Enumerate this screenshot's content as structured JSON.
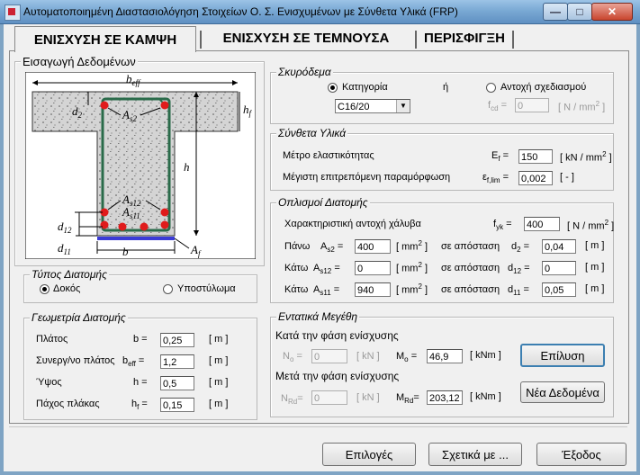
{
  "window": {
    "title": "Αυτοματοποιημένη Διαστασιολόγηση Στοιχείων Ο. Σ. Ενισχυμένων με Σύνθετα Υλικά  (FRP)",
    "min_glyph": "—",
    "max_glyph": "□",
    "close_glyph": "✕"
  },
  "tabs": [
    {
      "label": "ΕΝΙΣΧΥΣΗ ΣΕ ΚΑΜΨΗ",
      "active": true
    },
    {
      "label": "ΕΝΙΣΧΥΣΗ ΣΕ ΤΕΜΝΟΥΣΑ",
      "active": false
    },
    {
      "label": "ΠΕΡΙΣΦΙΓΞΗ",
      "active": false
    }
  ],
  "input_section": {
    "title": "Εισαγωγή Δεδομένων"
  },
  "diagram": {
    "labels": {
      "beff_b": "b",
      "beff_s": "eff",
      "d2_b": "d",
      "d2_s": "2",
      "as2_b": "A",
      "as2_s": "s2",
      "hf_b": "h",
      "hf_s": "f",
      "h": "h",
      "as12_b": "A",
      "as12_s": "s12",
      "as11_b": "A",
      "as11_s": "s11",
      "d12_b": "d",
      "d12_s": "12",
      "d11_b": "d",
      "d11_s": "11",
      "b": "b",
      "af_b": "A",
      "af_s": "f"
    }
  },
  "section_type": {
    "title": "Τύπος Διατομής",
    "options": [
      {
        "label": "Δοκός",
        "selected": true
      },
      {
        "label": "Υποστύλωμα",
        "selected": false
      }
    ]
  },
  "geometry": {
    "title": "Γεωμετρία Διατομής",
    "rows": [
      {
        "label": "Πλάτος",
        "sym": "b",
        "sub": "",
        "value": "0,25",
        "unit": "[ m ]"
      },
      {
        "label": "Συνεργ/νο πλάτος",
        "sym": "b",
        "sub": "eff",
        "value": "1,2",
        "unit": "[ m ]"
      },
      {
        "label": "Ύψος",
        "sym": "h",
        "sub": "",
        "value": "0,5",
        "unit": "[ m ]"
      },
      {
        "label": "Πάχος πλάκας",
        "sym": "h",
        "sub": "f",
        "value": "0,15",
        "unit": "[ m ]"
      }
    ]
  },
  "concrete": {
    "title": "Σκυρόδεμα",
    "opt_category": "Κατηγορία",
    "or": "ή",
    "opt_strength": "Αντοχή σχεδιασμού",
    "category_value": "C16/20",
    "fcd_sym": "f",
    "fcd_sub": "cd",
    "fcd_eq": "=",
    "fcd_value": "0",
    "fcd_unit": "[ N / mm",
    "fcd_unit_sup": "2",
    "fcd_unit_end": " ]"
  },
  "composites": {
    "title": "Σύνθετα Υλικά",
    "modulus_label": "Μέτρο ελαστικότητας",
    "modulus_sym": "E",
    "modulus_sub": "f",
    "modulus_eq": "=",
    "modulus_value": "150",
    "modulus_unit": "[ kN / mm",
    "modulus_unit_sup": "2",
    "modulus_unit_end": " ]",
    "strain_label": "Μέγιστη επιτρεπόμενη παραμόρφωση",
    "strain_sym": "ε",
    "strain_sub": "f,lim",
    "strain_eq": "=",
    "strain_value": "0,002",
    "strain_unit": "[ - ]"
  },
  "reinforcement": {
    "title": "Οπλισμοί Διατομής",
    "fyk_label": "Χαρακτηριστική  αντοχή χάλυβα",
    "fyk_sym": "f",
    "fyk_sub": "yk",
    "fyk_eq": "=",
    "fyk_value": "400",
    "fyk_unit": "[ N / mm",
    "fyk_unit_sup": "2",
    "fyk_unit_end": " ]",
    "rows": [
      {
        "pos": "Πάνω",
        "sym": "A",
        "sub": "s2",
        "value": "400",
        "unit": "[ mm",
        "unit_sup": "2",
        "unit_end": " ]",
        "dist_label": "σε απόσταση",
        "dsym": "d",
        "dsub": "2",
        "eq": "=",
        "dvalue": "0,04",
        "dunit": "[ m ]"
      },
      {
        "pos": "Κάτω",
        "sym": "A",
        "sub": "s12",
        "value": "0",
        "unit": "[ mm",
        "unit_sup": "2",
        "unit_end": " ]",
        "dist_label": "σε απόσταση",
        "dsym": "d",
        "dsub": "12",
        "eq": "=",
        "dvalue": "0",
        "dunit": "[ m ]"
      },
      {
        "pos": "Κάτω",
        "sym": "A",
        "sub": "s11",
        "value": "940",
        "unit": "[ mm",
        "unit_sup": "2",
        "unit_end": " ]",
        "dist_label": "σε απόσταση",
        "dsym": "d",
        "dsub": "11",
        "eq": "=",
        "dvalue": "0,05",
        "dunit": "[ m ]"
      }
    ]
  },
  "actions": {
    "title": "Εντατικά Μεγέθη",
    "during_label": "Κατά την φάση ενίσχυσης",
    "no_sym": "N",
    "no_sub": "o",
    "no_eq": "=",
    "no_value": "0",
    "no_unit": "[ kN ]",
    "mo_sym": "M",
    "mo_sub": "o",
    "mo_eq": "=",
    "mo_value": "46,9",
    "mo_unit": "[ kNm ]",
    "after_label": "Μετά την φάση ενίσχυσης",
    "nrd_sym": "N",
    "nrd_sub": "Rd",
    "nrd_eq": "=",
    "nrd_value": "0",
    "nrd_unit": "[ kN ]",
    "mrd_sym": "M",
    "mrd_sub": "Rd",
    "mrd_eq": "=",
    "mrd_value": "203,12",
    "mrd_unit": "[ kNm ]",
    "solve_button": "Επίλυση",
    "new_data_button": "Νέα Δεδομένα"
  },
  "footer": {
    "options_button": "Επιλογές",
    "about_button": "Σχετικά με ...",
    "exit_button": "Έξοδος"
  }
}
